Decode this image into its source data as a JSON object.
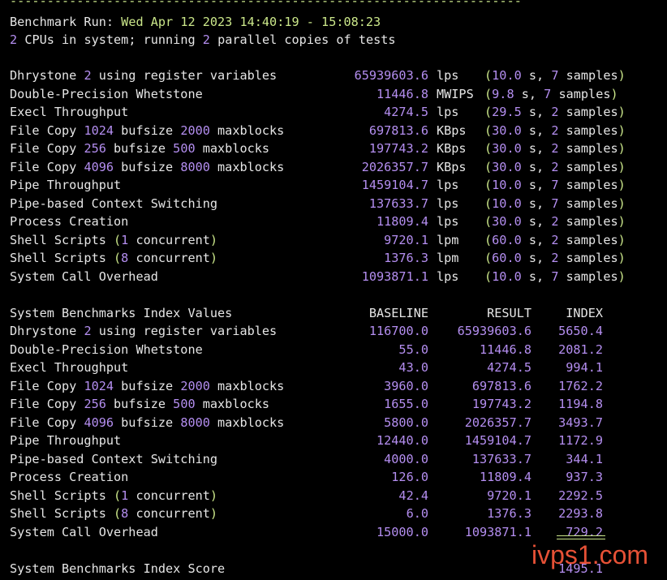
{
  "header": {
    "dashes": "---------------------------------------------------------------------",
    "run_label": "Benchmark Run:",
    "run_date": "Wed Apr 12 2023 14:40:19 - 15:08:23",
    "cpus_count": "2",
    "cpus_text1": "CPUs in system; running",
    "cpus_parallel": "2",
    "cpus_text2": "parallel copies of tests"
  },
  "results": [
    {
      "name": [
        [
          "Dhrystone ",
          "w"
        ],
        [
          "2",
          "n"
        ],
        [
          " using register variables",
          "w"
        ]
      ],
      "value": "65939603.6",
      "unit": "lps",
      "secs": "10.0",
      "samples": "7"
    },
    {
      "name": [
        [
          "Double-Precision Whetstone",
          "w"
        ]
      ],
      "value": "11446.8",
      "unit": "MWIPS",
      "secs": "9.8",
      "samples": "7"
    },
    {
      "name": [
        [
          "Execl Throughput",
          "w"
        ]
      ],
      "value": "4274.5",
      "unit": "lps",
      "secs": "29.5",
      "samples": "2"
    },
    {
      "name": [
        [
          "File Copy ",
          "w"
        ],
        [
          "1024",
          "n"
        ],
        [
          " bufsize ",
          "w"
        ],
        [
          "2000",
          "n"
        ],
        [
          " maxblocks",
          "w"
        ]
      ],
      "value": "697813.6",
      "unit": "KBps",
      "secs": "30.0",
      "samples": "2"
    },
    {
      "name": [
        [
          "File Copy ",
          "w"
        ],
        [
          "256",
          "n"
        ],
        [
          " bufsize ",
          "w"
        ],
        [
          "500",
          "n"
        ],
        [
          " maxblocks",
          "w"
        ]
      ],
      "value": "197743.2",
      "unit": "KBps",
      "secs": "30.0",
      "samples": "2"
    },
    {
      "name": [
        [
          "File Copy ",
          "w"
        ],
        [
          "4096",
          "n"
        ],
        [
          " bufsize ",
          "w"
        ],
        [
          "8000",
          "n"
        ],
        [
          " maxblocks",
          "w"
        ]
      ],
      "value": "2026357.7",
      "unit": "KBps",
      "secs": "30.0",
      "samples": "2"
    },
    {
      "name": [
        [
          "Pipe Throughput",
          "w"
        ]
      ],
      "value": "1459104.7",
      "unit": "lps",
      "secs": "10.0",
      "samples": "7"
    },
    {
      "name": [
        [
          "Pipe-based Context Switching",
          "w"
        ]
      ],
      "value": "137633.7",
      "unit": "lps",
      "secs": "10.0",
      "samples": "7"
    },
    {
      "name": [
        [
          "Process Creation",
          "w"
        ]
      ],
      "value": "11809.4",
      "unit": "lps",
      "secs": "30.0",
      "samples": "2"
    },
    {
      "name": [
        [
          "Shell Scripts ",
          "w"
        ],
        [
          "(",
          "g"
        ],
        [
          "1",
          "n"
        ],
        [
          " concurrent",
          "w"
        ],
        [
          ")",
          "g"
        ]
      ],
      "value": "9720.1",
      "unit": "lpm",
      "secs": "60.0",
      "samples": "2"
    },
    {
      "name": [
        [
          "Shell Scripts ",
          "w"
        ],
        [
          "(",
          "g"
        ],
        [
          "8",
          "n"
        ],
        [
          " concurrent",
          "w"
        ],
        [
          ")",
          "g"
        ]
      ],
      "value": "1376.3",
      "unit": "lpm",
      "secs": "60.0",
      "samples": "2"
    },
    {
      "name": [
        [
          "System Call Overhead",
          "w"
        ]
      ],
      "value": "1093871.1",
      "unit": "lps",
      "secs": "10.0",
      "samples": "7"
    }
  ],
  "result_labels": {
    "s": "s,",
    "samples": "samples",
    "open": "(",
    "close": ")"
  },
  "index": {
    "title": "System Benchmarks Index Values",
    "col_baseline": "BASELINE",
    "col_result": "RESULT",
    "col_index": "INDEX",
    "rows": [
      {
        "name": [
          [
            "Dhrystone ",
            "w"
          ],
          [
            "2",
            "n"
          ],
          [
            " using register variables",
            "w"
          ]
        ],
        "baseline": "116700.0",
        "result": "65939603.6",
        "index": "5650.4"
      },
      {
        "name": [
          [
            "Double-Precision Whetstone",
            "w"
          ]
        ],
        "baseline": "55.0",
        "result": "11446.8",
        "index": "2081.2"
      },
      {
        "name": [
          [
            "Execl Throughput",
            "w"
          ]
        ],
        "baseline": "43.0",
        "result": "4274.5",
        "index": "994.1"
      },
      {
        "name": [
          [
            "File Copy ",
            "w"
          ],
          [
            "1024",
            "n"
          ],
          [
            " bufsize ",
            "w"
          ],
          [
            "2000",
            "n"
          ],
          [
            " maxblocks",
            "w"
          ]
        ],
        "baseline": "3960.0",
        "result": "697813.6",
        "index": "1762.2"
      },
      {
        "name": [
          [
            "File Copy ",
            "w"
          ],
          [
            "256",
            "n"
          ],
          [
            " bufsize ",
            "w"
          ],
          [
            "500",
            "n"
          ],
          [
            " maxblocks",
            "w"
          ]
        ],
        "baseline": "1655.0",
        "result": "197743.2",
        "index": "1194.8"
      },
      {
        "name": [
          [
            "File Copy ",
            "w"
          ],
          [
            "4096",
            "n"
          ],
          [
            " bufsize ",
            "w"
          ],
          [
            "8000",
            "n"
          ],
          [
            " maxblocks",
            "w"
          ]
        ],
        "baseline": "5800.0",
        "result": "2026357.7",
        "index": "3493.7"
      },
      {
        "name": [
          [
            "Pipe Throughput",
            "w"
          ]
        ],
        "baseline": "12440.0",
        "result": "1459104.7",
        "index": "1172.9"
      },
      {
        "name": [
          [
            "Pipe-based Context Switching",
            "w"
          ]
        ],
        "baseline": "4000.0",
        "result": "137633.7",
        "index": "344.1"
      },
      {
        "name": [
          [
            "Process Creation",
            "w"
          ]
        ],
        "baseline": "126.0",
        "result": "11809.4",
        "index": "937.3"
      },
      {
        "name": [
          [
            "Shell Scripts ",
            "w"
          ],
          [
            "(",
            "g"
          ],
          [
            "1",
            "n"
          ],
          [
            " concurrent",
            "w"
          ],
          [
            ")",
            "g"
          ]
        ],
        "baseline": "42.4",
        "result": "9720.1",
        "index": "2292.5"
      },
      {
        "name": [
          [
            "Shell Scripts ",
            "w"
          ],
          [
            "(",
            "g"
          ],
          [
            "8",
            "n"
          ],
          [
            " concurrent",
            "w"
          ],
          [
            ")",
            "g"
          ]
        ],
        "baseline": "6.0",
        "result": "1376.3",
        "index": "2293.8"
      },
      {
        "name": [
          [
            "System Call Overhead",
            "w"
          ]
        ],
        "baseline": "15000.0",
        "result": "1093871.1",
        "index": "729.2"
      }
    ],
    "score_label": "System Benchmarks Index Score",
    "score_value": "1495.1"
  },
  "watermark": "ivps1.com",
  "colors": {
    "background": "#000000",
    "text": "#e6e6e6",
    "number": "#b48ef0",
    "accent": "#cbe78a",
    "watermark": "#ff5a3c"
  }
}
